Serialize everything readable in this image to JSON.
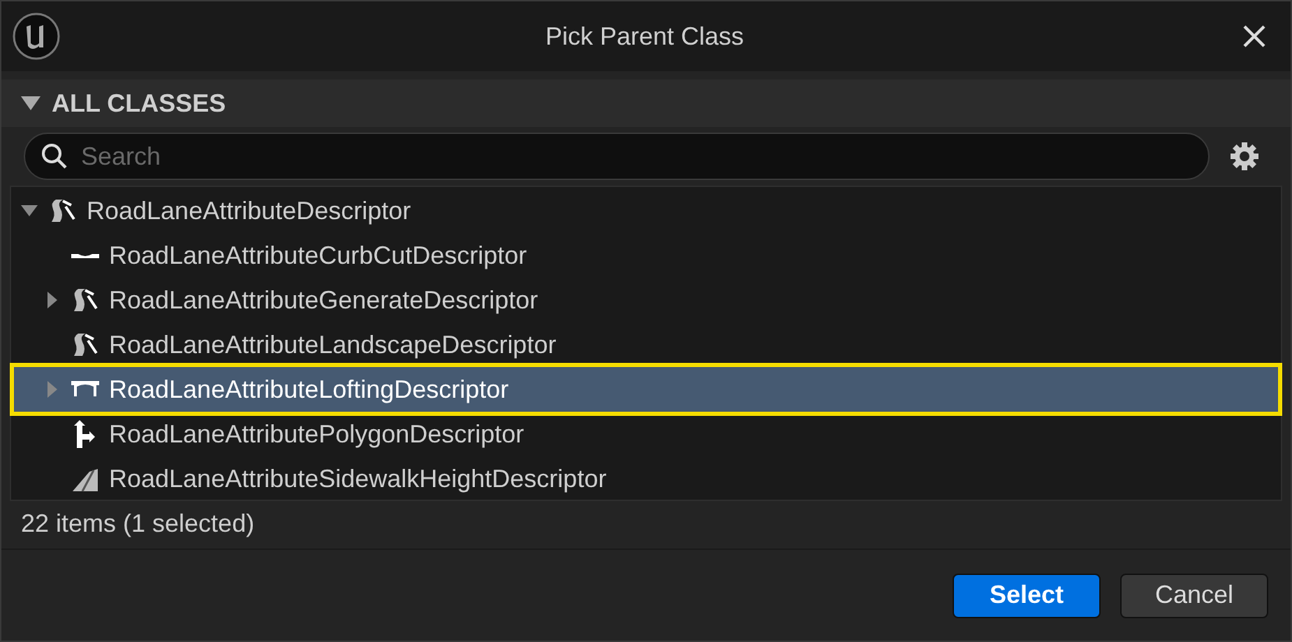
{
  "window": {
    "title": "Pick Parent Class"
  },
  "section": {
    "title": "ALL CLASSES",
    "expanded": true
  },
  "search": {
    "placeholder": "Search"
  },
  "tree": [
    {
      "label": "RoadLaneAttributeDescriptor",
      "kind": "road",
      "expanded": true,
      "selected": false,
      "children": [
        {
          "label": "RoadLaneAttributeCurbCutDescriptor",
          "kind": "curb",
          "selected": false
        },
        {
          "label": "RoadLaneAttributeGenerateDescriptor",
          "kind": "road",
          "expanded": false,
          "selected": false
        },
        {
          "label": "RoadLaneAttributeLandscapeDescriptor",
          "kind": "road",
          "selected": false
        },
        {
          "label": "RoadLaneAttributeLoftingDescriptor",
          "kind": "arch",
          "expanded": false,
          "selected": true
        },
        {
          "label": "RoadLaneAttributePolygonDescriptor",
          "kind": "split",
          "selected": false
        },
        {
          "label": "RoadLaneAttributeSidewalkHeightDescriptor",
          "kind": "ramp",
          "selected": false
        }
      ]
    }
  ],
  "status": "22 items (1 selected)",
  "buttons": [
    {
      "label": "Select",
      "kind": "primary"
    },
    {
      "label": "Cancel",
      "kind": "secondary"
    }
  ]
}
